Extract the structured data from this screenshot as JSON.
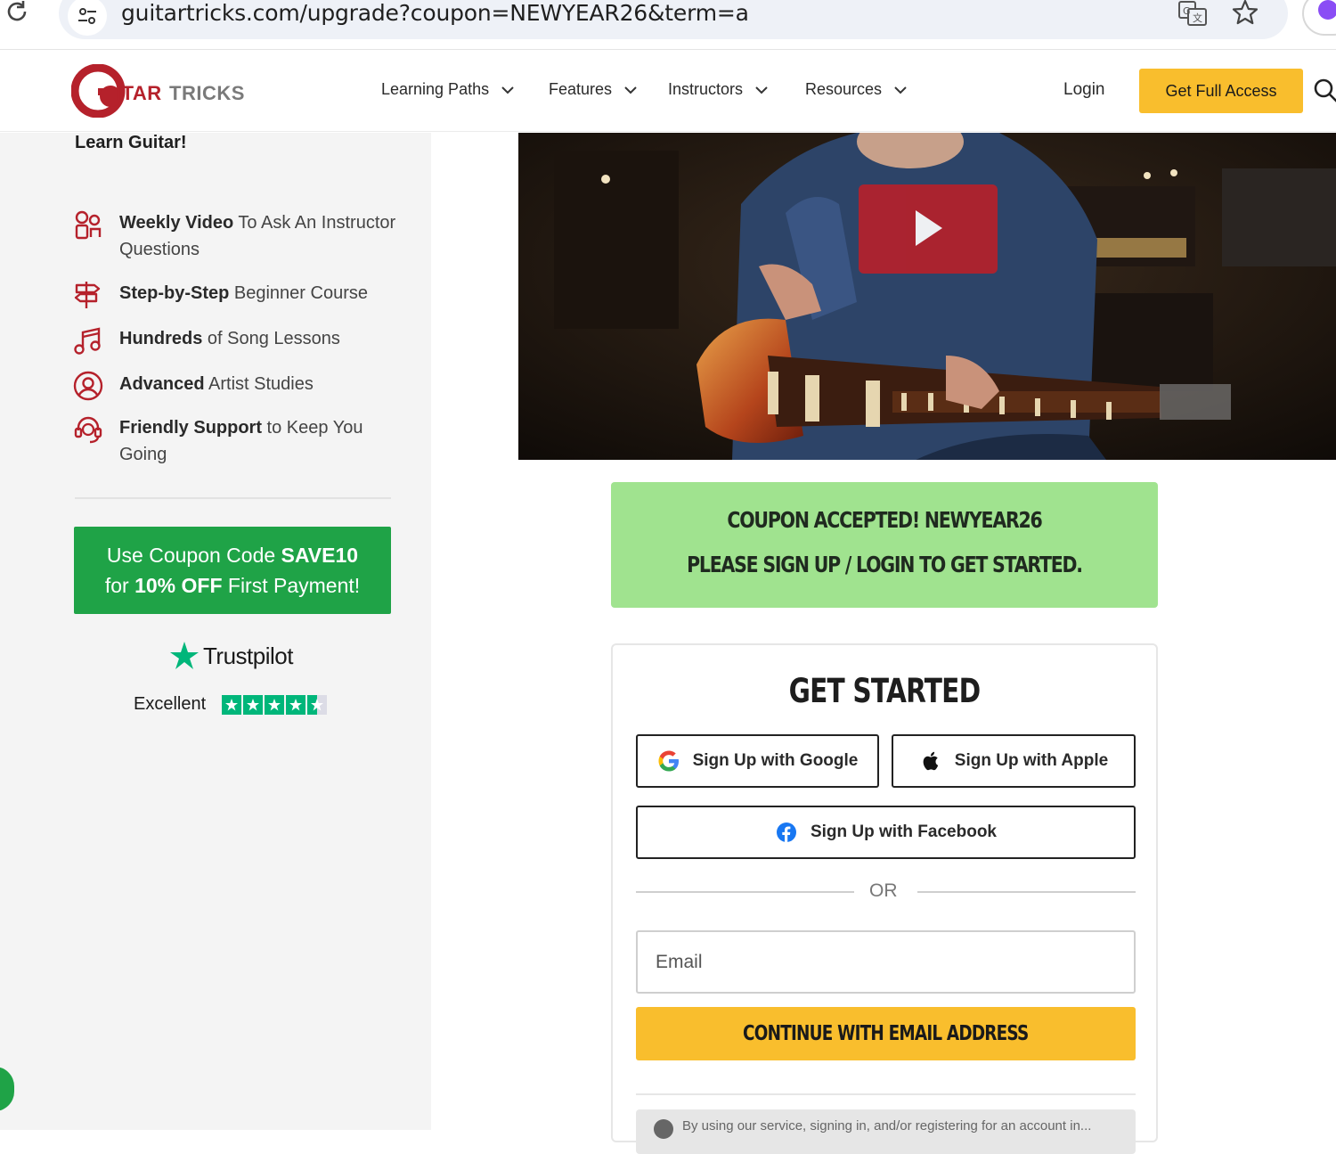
{
  "browser": {
    "url": "guitartricks.com/upgrade?coupon=NEWYEAR26&term=a"
  },
  "header": {
    "logo_text": "GUITARTRICKS",
    "nav": [
      {
        "label": "Learning Paths"
      },
      {
        "label": "Features"
      },
      {
        "label": "Instructors"
      },
      {
        "label": "Resources"
      }
    ],
    "login_label": "Login",
    "cta_label": "Get Full Access"
  },
  "sidebar": {
    "heading": "Learn Guitar!",
    "features": [
      {
        "bold": "Weekly Video",
        "rest": " To Ask An Instructor Questions",
        "icon": "users-icon"
      },
      {
        "bold": "Step-by-Step",
        "rest": " Beginner Course",
        "icon": "signpost-icon"
      },
      {
        "bold": "Hundreds",
        "rest": " of Song Lessons",
        "icon": "music-note-icon"
      },
      {
        "bold": "Advanced",
        "rest": " Artist Studies",
        "icon": "user-circle-icon"
      },
      {
        "bold": "Friendly Support",
        "rest": " to Keep You Going",
        "icon": "headset-icon"
      }
    ],
    "coupon": {
      "line1_pre": "Use Coupon Code ",
      "line1_code": "SAVE10",
      "line2_pre": "for ",
      "line2_bold": "10% OFF",
      "line2_post": " First Payment!"
    },
    "trustpilot": {
      "brand": "Trustpilot",
      "rating_label": "Excellent",
      "stars": 4.5
    }
  },
  "notice": {
    "line1": "COUPON ACCEPTED! NEWYEAR26",
    "line2": "PLEASE SIGN UP / LOGIN TO GET STARTED."
  },
  "signup": {
    "title": "GET STARTED",
    "google_label": "Sign Up with Google",
    "apple_label": "Sign Up with Apple",
    "facebook_label": "Sign Up with Facebook",
    "or_label": "OR",
    "email_placeholder": "Email",
    "continue_label": "CONTINUE WITH EMAIL ADDRESS",
    "terms_text": "By using our service, signing in, and/or registering for an account in..."
  },
  "colors": {
    "brand_red": "#b5212b",
    "cta_yellow": "#f9be2d",
    "coupon_green": "#1fa347",
    "notice_green": "#a0e38f",
    "trustpilot_green": "#00b67a"
  }
}
